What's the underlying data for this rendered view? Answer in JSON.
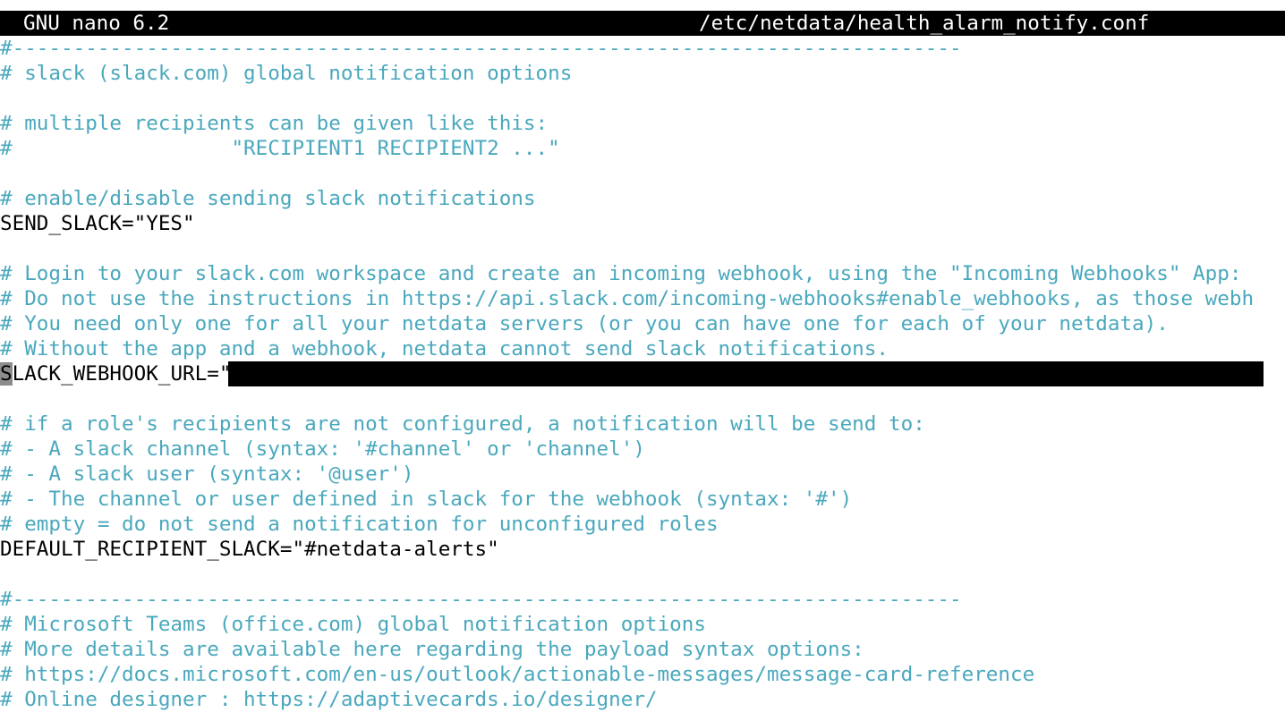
{
  "app": {
    "name": "GNU nano 6.2",
    "file": "/etc/netdata/health_alarm_notify.conf"
  },
  "colors": {
    "comment": "#4aa8bd",
    "code": "#000000",
    "titlebar_bg": "#000000",
    "titlebar_fg": "#ffffff",
    "cursor": "#8c8c8c"
  },
  "lines": [
    "#------------------------------------------------------------------------------",
    "# slack (slack.com) global notification options",
    "",
    "# multiple recipients can be given like this:",
    "#                  \"RECIPIENT1 RECIPIENT2 ...\"",
    "",
    "# enable/disable sending slack notifications",
    "SEND_SLACK=\"YES\"",
    "",
    "# Login to your slack.com workspace and create an incoming webhook, using the \"Incoming Webhooks\" App: ",
    "# Do not use the instructions in https://api.slack.com/incoming-webhooks#enable_webhooks, as those webh",
    "# You need only one for all your netdata servers (or you can have one for each of your netdata).",
    "# Without the app and a webhook, netdata cannot send slack notifications.",
    {
      "cursor_char": "S",
      "rest": "LACK_WEBHOOK_URL=\""
    },
    "",
    "# if a role's recipients are not configured, a notification will be send to:",
    "# - A slack channel (syntax: '#channel' or 'channel')",
    "# - A slack user (syntax: '@user')",
    "# - The channel or user defined in slack for the webhook (syntax: '#')",
    "# empty = do not send a notification for unconfigured roles",
    "DEFAULT_RECIPIENT_SLACK=\"#netdata-alerts\"",
    "",
    "#------------------------------------------------------------------------------",
    "# Microsoft Teams (office.com) global notification options",
    "# More details are available here regarding the payload syntax options:",
    "# https://docs.microsoft.com/en-us/outlook/actionable-messages/message-card-reference",
    "# Online designer : https://adaptivecards.io/designer/"
  ]
}
